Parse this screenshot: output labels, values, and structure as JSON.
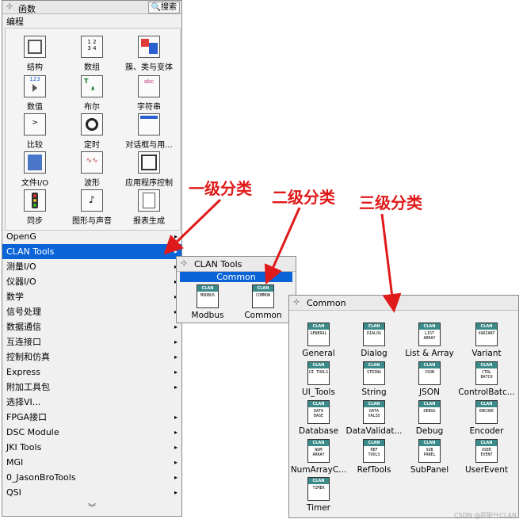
{
  "palette": {
    "title": "函数",
    "search_label": "搜索",
    "category": "编程",
    "items": [
      {
        "label": "结构",
        "icon": "structure-icon"
      },
      {
        "label": "数组",
        "icon": "array-icon"
      },
      {
        "label": "簇、类与变体",
        "icon": "cluster-class-variant-icon"
      },
      {
        "label": "数值",
        "icon": "numeric-icon"
      },
      {
        "label": "布尔",
        "icon": "boolean-icon"
      },
      {
        "label": "字符串",
        "icon": "string-icon"
      },
      {
        "label": "比较",
        "icon": "comparison-icon"
      },
      {
        "label": "定时",
        "icon": "timing-icon"
      },
      {
        "label": "对话框与用...",
        "icon": "dialog-ui-icon"
      },
      {
        "label": "文件I/O",
        "icon": "file-io-icon"
      },
      {
        "label": "波形",
        "icon": "waveform-icon"
      },
      {
        "label": "应用程序控制",
        "icon": "app-control-icon"
      },
      {
        "label": "同步",
        "icon": "synchronization-icon"
      },
      {
        "label": "图形与声音",
        "icon": "graphics-sound-icon"
      },
      {
        "label": "报表生成",
        "icon": "report-generation-icon"
      }
    ],
    "menu": [
      {
        "label": "OpenG",
        "arrow": true
      },
      {
        "label": "CLAN Tools",
        "arrow": true,
        "selected": true
      },
      {
        "label": "测量I/O",
        "arrow": true
      },
      {
        "label": "仪器I/O",
        "arrow": true
      },
      {
        "label": "数学",
        "arrow": true
      },
      {
        "label": "信号处理",
        "arrow": true
      },
      {
        "label": "数据通信",
        "arrow": true
      },
      {
        "label": "互连接口",
        "arrow": true
      },
      {
        "label": "控制和仿真",
        "arrow": true
      },
      {
        "label": "Express",
        "arrow": true
      },
      {
        "label": "附加工具包",
        "arrow": true
      },
      {
        "label": "选择VI...",
        "arrow": false
      },
      {
        "label": "FPGA接口",
        "arrow": true
      },
      {
        "label": "DSC Module",
        "arrow": true
      },
      {
        "label": "JKI Tools",
        "arrow": true
      },
      {
        "label": "MGI",
        "arrow": true
      },
      {
        "label": "0_JasonBroTools",
        "arrow": true
      },
      {
        "label": "QSI",
        "arrow": true
      }
    ],
    "arrow_glyph": "▸",
    "more_glyph": "︾"
  },
  "clan_panel": {
    "title": "CLAN Tools",
    "highlight": "Common",
    "items": [
      {
        "label": "Modbus",
        "icon_band": "CLAN",
        "icon_text": "MODBUS"
      },
      {
        "label": "Common",
        "icon_band": "CLAN",
        "icon_text": "COMMON"
      }
    ]
  },
  "common_panel": {
    "title": "Common",
    "items": [
      {
        "label": "General",
        "icon_band": "CLAN",
        "icon_text": "GENERAL"
      },
      {
        "label": "Dialog",
        "icon_band": "CLAN",
        "icon_text": "DIALOG"
      },
      {
        "label": "List & Array",
        "icon_band": "CLAN",
        "icon_text": "LIST ARRAY"
      },
      {
        "label": "Variant",
        "icon_band": "CLAN",
        "icon_text": "VARIANT"
      },
      {
        "label": "UI_Tools",
        "icon_band": "CLAN",
        "icon_text": "UI TOOLS"
      },
      {
        "label": "String",
        "icon_band": "CLAN",
        "icon_text": "STRING"
      },
      {
        "label": "JSON",
        "icon_band": "CLAN",
        "icon_text": "JSON"
      },
      {
        "label": "ControlBatc...",
        "icon_band": "CLAN",
        "icon_text": "CTRL BATCH"
      },
      {
        "label": "Database",
        "icon_band": "CLAN",
        "icon_text": "DATA BASE"
      },
      {
        "label": "DataValidat...",
        "icon_band": "CLAN",
        "icon_text": "DATA VALID"
      },
      {
        "label": "Debug",
        "icon_band": "CLAN",
        "icon_text": "DEBUG"
      },
      {
        "label": "Encoder",
        "icon_band": "CLAN",
        "icon_text": "ENCODE"
      },
      {
        "label": "NumArrayC...",
        "icon_band": "CLAN",
        "icon_text": "NUM ARRAY"
      },
      {
        "label": "RefTools",
        "icon_band": "CLAN",
        "icon_text": "REF TOOLS"
      },
      {
        "label": "SubPanel",
        "icon_band": "CLAN",
        "icon_text": "SUB PANEL"
      },
      {
        "label": "UserEvent",
        "icon_band": "CLAN",
        "icon_text": "USER EVENT"
      },
      {
        "label": "Timer",
        "icon_band": "CLAN",
        "icon_text": "TIMER"
      }
    ]
  },
  "annotations": {
    "level1": "一级分类",
    "level2": "二级分类",
    "level3": "三级分类",
    "color": "#e01a1a"
  },
  "watermark": "CSDN @阿斯什CLAN",
  "colors": {
    "selection": "#0a64d8",
    "clan_band": "#3a8a8a"
  }
}
